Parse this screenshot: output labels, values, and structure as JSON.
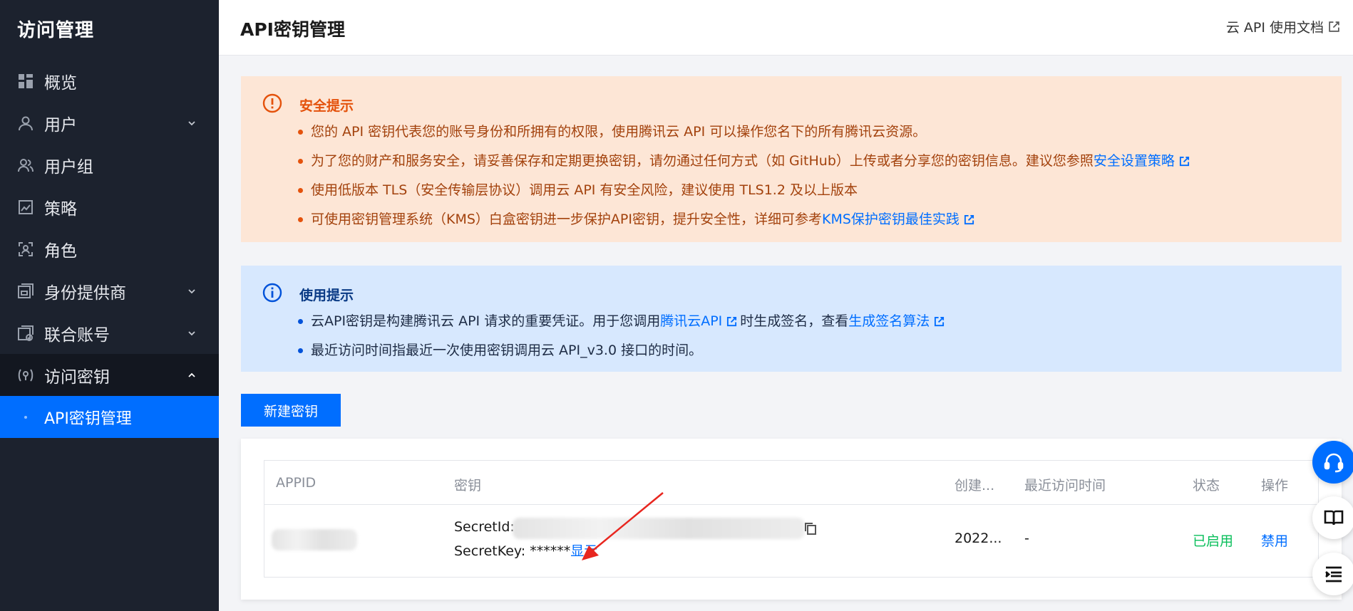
{
  "sidebar": {
    "title": "访问管理",
    "items": [
      {
        "label": "概览",
        "icon": "grid-icon"
      },
      {
        "label": "用户",
        "icon": "user-icon"
      },
      {
        "label": "用户组",
        "icon": "user-group-icon"
      },
      {
        "label": "策略",
        "icon": "policy-icon"
      },
      {
        "label": "角色",
        "icon": "role-icon"
      },
      {
        "label": "身份提供商",
        "icon": "identity-provider-icon"
      },
      {
        "label": "联合账号",
        "icon": "federated-account-icon"
      },
      {
        "label": "访问密钥",
        "icon": "access-key-icon"
      }
    ],
    "sub_item": {
      "label": "API密钥管理"
    }
  },
  "header": {
    "title": "API密钥管理",
    "doc_link": "云 API 使用文档"
  },
  "security_alert": {
    "title": "安全提示",
    "items": [
      "您的 API 密钥代表您的账号身份和所拥有的权限，使用腾讯云 API 可以操作您名下的所有腾讯云资源。",
      {
        "text": "为了您的财产和服务安全，请妥善保存和定期更换密钥，请勿通过任何方式（如 GitHub）上传或者分享您的密钥信息。建议您参照",
        "link": "安全设置策略"
      },
      "使用低版本 TLS（安全传输层协议）调用云 API 有安全风险，建议使用 TLS1.2 及以上版本",
      {
        "text": "可使用密钥管理系统（KMS）白盒密钥进一步保护API密钥，提升安全性，详细可参考",
        "link": "KMS保护密钥最佳实践"
      }
    ]
  },
  "usage_alert": {
    "title": "使用提示",
    "item1": {
      "prefix": "云API密钥是构建腾讯云 API 请求的重要凭证。用于您调用",
      "link1": "腾讯云API",
      "middle": "时生成签名，查看",
      "link2": "生成签名算法"
    },
    "item2": "最近访问时间指最近一次使用密钥调用云 API_v3.0 接口的时间。"
  },
  "create_button": "新建密钥",
  "table": {
    "headers": [
      "APPID",
      "密钥",
      "创建...",
      "最近访问时间",
      "状态",
      "操作"
    ],
    "row": {
      "secret_id_label": "SecretId:",
      "secret_key_label": "SecretKey: ******",
      "show_link": "显示",
      "created": "2022...",
      "last_access": "-",
      "status": "已启用",
      "action": "禁用"
    }
  },
  "colors": {
    "accent": "#006eff",
    "sidebar_bg": "#1c222e",
    "warning_bg": "#fde6d6",
    "info_bg": "#d7e8fe",
    "status_enabled": "#0abf5b"
  }
}
